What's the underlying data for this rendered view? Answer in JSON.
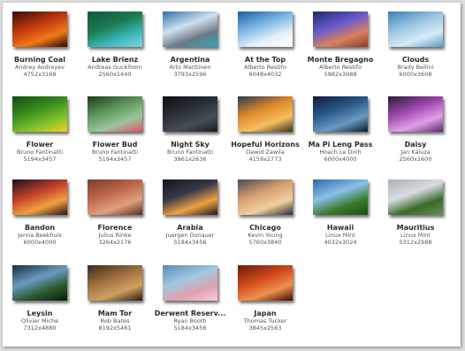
{
  "wallpapers": [
    {
      "title": "Burning Coal",
      "author": "Andrey Andreyev",
      "resolution": "4752x3168",
      "colors": [
        "#3a0d06",
        "#c0360c",
        "#f07a1a",
        "#2a0804"
      ]
    },
    {
      "title": "Lake Brienz",
      "author": "Andreas Gucklhorn",
      "resolution": "2560x1440",
      "colors": [
        "#0f5a3c",
        "#1c7a50",
        "#3ab6b8",
        "#7fd6e0"
      ]
    },
    {
      "title": "Argentina",
      "author": "Arto Marttinen",
      "resolution": "3793x2596",
      "colors": [
        "#2f6fb0",
        "#cfe0ee",
        "#6b7a84",
        "#2aa8b8"
      ]
    },
    {
      "title": "At the Top",
      "author": "Alberto Restifo",
      "resolution": "6048x4032",
      "colors": [
        "#1b5fa8",
        "#7fb8e6",
        "#e6f0f8",
        "#ffffff"
      ]
    },
    {
      "title": "Monte Bregagno",
      "author": "Alberto Restifo",
      "resolution": "5982x3988",
      "colors": [
        "#1a2a6c",
        "#6a5acd",
        "#d9825a",
        "#8a3a2a"
      ]
    },
    {
      "title": "Clouds",
      "author": "Brady Bellini",
      "resolution": "6000x3608",
      "colors": [
        "#3a7fb8",
        "#9cc6e2",
        "#d8ebf6",
        "#5e9ac8"
      ]
    },
    {
      "title": "Flower",
      "author": "Bruno Fantinatti",
      "resolution": "5194x3457",
      "colors": [
        "#0f4a12",
        "#3c8f1e",
        "#7fc02c",
        "#f2d21e"
      ]
    },
    {
      "title": "Flower Bud",
      "author": "Bruno Fantinatti",
      "resolution": "5194x3457",
      "colors": [
        "#1a3a1a",
        "#5f9a5f",
        "#9cc49c",
        "#e0506a"
      ]
    },
    {
      "title": "Night Sky",
      "author": "Bruno Fantinatti",
      "resolution": "3961x2636",
      "colors": [
        "#0c0f14",
        "#2a3038",
        "#454d55",
        "#1a1d22"
      ]
    },
    {
      "title": "Hopeful Horizons",
      "author": "Dawid Zawila",
      "resolution": "4159x2773",
      "colors": [
        "#2a3a4a",
        "#e08a2a",
        "#f4c060",
        "#3a3020"
      ]
    },
    {
      "title": "Ma Pi Leng Pass",
      "author": "Hoach Le Dinh",
      "resolution": "6000x4000",
      "colors": [
        "#0d1c3a",
        "#2a5a8a",
        "#6a9ac0",
        "#0a1a2a"
      ]
    },
    {
      "title": "Daisy",
      "author": "Jan Kaluza",
      "resolution": "2560x1600",
      "colors": [
        "#2a1a3a",
        "#a04ab0",
        "#e0a0e8",
        "#5a2a6a"
      ]
    },
    {
      "title": "Bandon",
      "author": "Jenna Beekhuis",
      "resolution": "6000x4000",
      "colors": [
        "#1a1020",
        "#c0402a",
        "#f2a040",
        "#201418"
      ]
    },
    {
      "title": "Florence",
      "author": "Julius Rinke",
      "resolution": "3264x2176",
      "colors": [
        "#7a3a2a",
        "#c0684a",
        "#e0a080",
        "#5a2a20"
      ]
    },
    {
      "title": "Arabia",
      "author": "Juergen Donauer",
      "resolution": "5184x3456",
      "colors": [
        "#101420",
        "#3a3a48",
        "#f0a040",
        "#1a1a24"
      ]
    },
    {
      "title": "Chicago",
      "author": "Kevin Young",
      "resolution": "5760x3840",
      "colors": [
        "#4a4a52",
        "#d8a070",
        "#f0d0a0",
        "#2a2a30"
      ]
    },
    {
      "title": "Hawaii",
      "author": "Linux Mint",
      "resolution": "4032x3024",
      "colors": [
        "#2a6aa8",
        "#8ac0e8",
        "#3a7a2a",
        "#1a4a1a"
      ]
    },
    {
      "title": "Mauritius",
      "author": "Linux Mint",
      "resolution": "5312x2988",
      "colors": [
        "#a8b0b8",
        "#d8dce0",
        "#3a6a2a",
        "#6a8a5a"
      ]
    },
    {
      "title": "Leysin",
      "author": "Olivier Miche",
      "resolution": "7312x4880",
      "colors": [
        "#1a2a3a",
        "#6a9ac0",
        "#2a5a2a",
        "#0a1a10"
      ]
    },
    {
      "title": "Mam Tor",
      "author": "Rob Bates",
      "resolution": "8192x5461",
      "colors": [
        "#3a2a1a",
        "#a07040",
        "#d0a060",
        "#2a1a10"
      ]
    },
    {
      "title": "Derwent Reserv...",
      "author": "Ryan Booth",
      "resolution": "5184x3456",
      "colors": [
        "#5a8ab0",
        "#a0c8e0",
        "#e0a0b0",
        "#f0d0d8"
      ]
    },
    {
      "title": "Japan",
      "author": "Thomas Tucker",
      "resolution": "3845x2563",
      "colors": [
        "#6a1a0a",
        "#d04a1a",
        "#f09050",
        "#3a0a05"
      ]
    }
  ]
}
